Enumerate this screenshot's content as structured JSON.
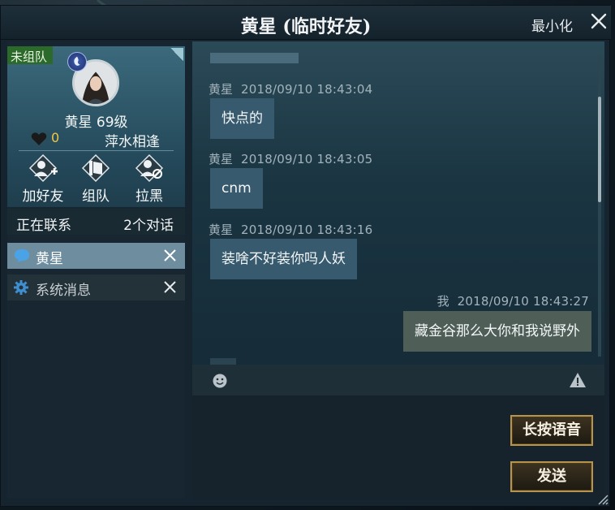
{
  "window": {
    "title": "黄星 (临时好友)",
    "minimize_label": "最小化"
  },
  "profile": {
    "team_status": "未组队",
    "name_level": "黄星  69级",
    "hearts": "0",
    "relation": "萍水相逢",
    "actions": [
      {
        "label": "加好友",
        "icon": "add-friend-icon"
      },
      {
        "label": "组队",
        "icon": "team-icon"
      },
      {
        "label": "拉黑",
        "icon": "block-icon"
      }
    ]
  },
  "contacts": {
    "title": "正在联系",
    "count": "2个对话",
    "items": [
      {
        "label": "黄星",
        "icon": "chat-bubble-icon",
        "active": true
      },
      {
        "label": "系统消息",
        "icon": "gear-icon",
        "active": false
      }
    ]
  },
  "messages": [
    {
      "sender": "黄星",
      "time": "2018/09/10  18:43:04",
      "text": "快点的",
      "direction": "in"
    },
    {
      "sender": "黄星",
      "time": "2018/09/10  18:43:05",
      "text": "cnm",
      "direction": "in"
    },
    {
      "sender": "黄星",
      "time": "2018/09/10  18:43:16",
      "text": "装啥不好装你吗人妖",
      "direction": "in"
    },
    {
      "sender": "我",
      "time": "2018/09/10  18:43:27",
      "text": "藏金谷那么大你和我说野外",
      "direction": "out"
    }
  ],
  "buttons": {
    "voice": "长按语音",
    "send": "发送"
  },
  "colors": {
    "accent_gold": "#b6944e",
    "active_conversation": "#6e8ea0",
    "team_badge": "#2b6a2a",
    "hearts_count": "#f2c744"
  }
}
